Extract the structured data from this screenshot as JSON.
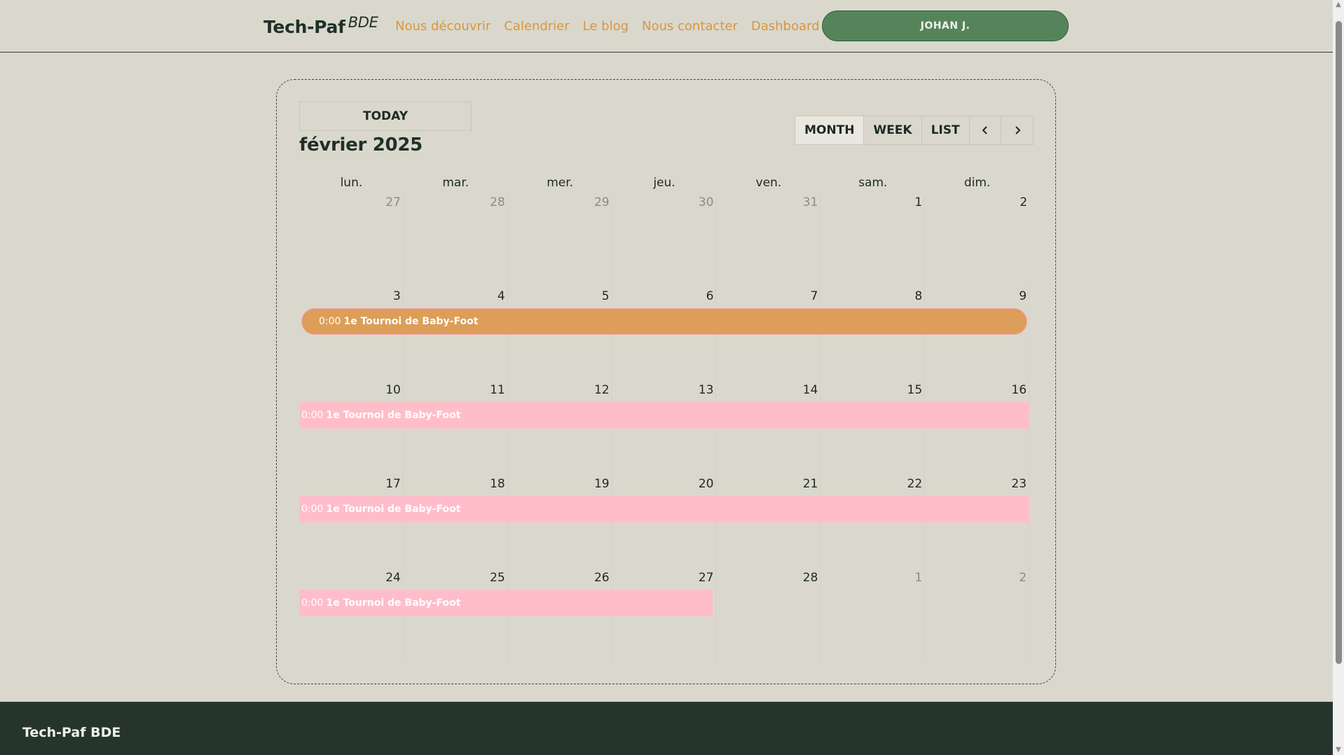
{
  "header": {
    "brand": "Tech-Paf",
    "brand_sup": "BDE",
    "nav": [
      "Nous découvrir",
      "Calendrier",
      "Le blog",
      "Nous contacter",
      "Dashboard"
    ],
    "user_button": "JOHAN J."
  },
  "calendar": {
    "today_label": "TODAY",
    "title": "février 2025",
    "views": [
      "MONTH",
      "WEEK",
      "LIST"
    ],
    "active_view": "MONTH",
    "prev_icon": "chevron-left-icon",
    "next_icon": "chevron-right-icon",
    "days_of_week": [
      "lun.",
      "mar.",
      "mer.",
      "jeu.",
      "ven.",
      "sam.",
      "dim."
    ],
    "weeks": [
      [
        "27",
        "28",
        "29",
        "30",
        "31",
        "1",
        "2"
      ],
      [
        "3",
        "4",
        "5",
        "6",
        "7",
        "8",
        "9"
      ],
      [
        "10",
        "11",
        "12",
        "13",
        "14",
        "15",
        "16"
      ],
      [
        "17",
        "18",
        "19",
        "20",
        "21",
        "22",
        "23"
      ],
      [
        "24",
        "25",
        "26",
        "27",
        "28",
        "1",
        "2"
      ]
    ],
    "event": {
      "time": "0:00",
      "name": "1e Tournoi de Baby-Foot"
    },
    "colors": {
      "event_highlight": "#dc9e58",
      "event_regular": "#ffbdca"
    }
  },
  "footer": {
    "brand": "Tech-Paf BDE"
  },
  "colors": {
    "background": "#dad8cc",
    "accent_green": "#56845a",
    "link_orange": "#d8963f",
    "footer_bg": "#25352e"
  }
}
